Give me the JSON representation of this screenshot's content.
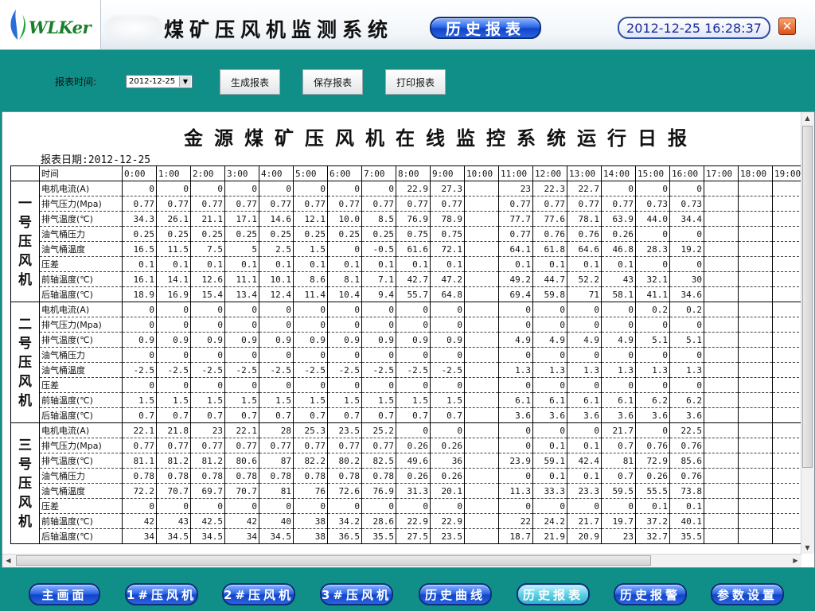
{
  "app": {
    "logo_text": "WLKer",
    "system_title": "煤矿压风机监测系统",
    "section_badge": "历史报表",
    "clock": "2012-12-25 16:28:37",
    "close_glyph": "✕"
  },
  "toolbar": {
    "date_label": "报表时间:",
    "date_value": "2012-12-25",
    "buttons": [
      "生成报表",
      "保存报表",
      "打印报表"
    ]
  },
  "report": {
    "title": "金源煤矿压风机在线监控系统运行日报",
    "date_line": "报表日期:2012-12-25",
    "time_header": "时间",
    "hours": [
      "0:00",
      "1:00",
      "2:00",
      "3:00",
      "4:00",
      "5:00",
      "6:00",
      "7:00",
      "8:00",
      "9:00",
      "10:00",
      "11:00",
      "12:00",
      "13:00",
      "14:00",
      "15:00",
      "16:00",
      "17:00",
      "18:00",
      "19:00"
    ],
    "groups": [
      {
        "name": "一号压风机",
        "rows": [
          {
            "label": "电机电流(A)",
            "values": [
              "0",
              "0",
              "0",
              "0",
              "0",
              "0",
              "0",
              "0",
              "22.9",
              "27.3",
              "",
              "23",
              "22.3",
              "22.7",
              "0",
              "0",
              "0",
              "",
              "",
              ""
            ]
          },
          {
            "label": "排气压力(Mpa)",
            "values": [
              "0.77",
              "0.77",
              "0.77",
              "0.77",
              "0.77",
              "0.77",
              "0.77",
              "0.77",
              "0.77",
              "0.77",
              "",
              "0.77",
              "0.77",
              "0.77",
              "0.77",
              "0.73",
              "0.73",
              "",
              "",
              ""
            ]
          },
          {
            "label": "排气温度(℃)",
            "values": [
              "34.3",
              "26.1",
              "21.1",
              "17.1",
              "14.6",
              "12.1",
              "10.0",
              "8.5",
              "76.9",
              "78.9",
              "",
              "77.7",
              "77.6",
              "78.1",
              "63.9",
              "44.0",
              "34.4",
              "",
              "",
              ""
            ]
          },
          {
            "label": "油气桶压力",
            "values": [
              "0.25",
              "0.25",
              "0.25",
              "0.25",
              "0.25",
              "0.25",
              "0.25",
              "0.25",
              "0.75",
              "0.75",
              "",
              "0.77",
              "0.76",
              "0.76",
              "0.26",
              "0",
              "0",
              "",
              "",
              ""
            ]
          },
          {
            "label": "油气桶温度",
            "values": [
              "16.5",
              "11.5",
              "7.5",
              "5",
              "2.5",
              "1.5",
              "0",
              "-0.5",
              "61.6",
              "72.1",
              "",
              "64.1",
              "61.8",
              "64.6",
              "46.8",
              "28.3",
              "19.2",
              "",
              "",
              ""
            ]
          },
          {
            "label": "压差",
            "values": [
              "0.1",
              "0.1",
              "0.1",
              "0.1",
              "0.1",
              "0.1",
              "0.1",
              "0.1",
              "0.1",
              "0.1",
              "",
              "0.1",
              "0.1",
              "0.1",
              "0.1",
              "0",
              "0",
              "",
              "",
              ""
            ]
          },
          {
            "label": "前轴温度(℃)",
            "values": [
              "16.1",
              "14.1",
              "12.6",
              "11.1",
              "10.1",
              "8.6",
              "8.1",
              "7.1",
              "42.7",
              "47.2",
              "",
              "49.2",
              "44.7",
              "52.2",
              "43",
              "32.1",
              "30",
              "",
              "",
              ""
            ]
          },
          {
            "label": "后轴温度(℃)",
            "values": [
              "18.9",
              "16.9",
              "15.4",
              "13.4",
              "12.4",
              "11.4",
              "10.4",
              "9.4",
              "55.7",
              "64.8",
              "",
              "69.4",
              "59.8",
              "71",
              "58.1",
              "41.1",
              "34.6",
              "",
              "",
              ""
            ]
          }
        ]
      },
      {
        "name": "二号压风机",
        "rows": [
          {
            "label": "电机电流(A)",
            "values": [
              "0",
              "0",
              "0",
              "0",
              "0",
              "0",
              "0",
              "0",
              "0",
              "0",
              "",
              "0",
              "0",
              "0",
              "0",
              "0.2",
              "0.2",
              "",
              "",
              ""
            ]
          },
          {
            "label": "排气压力(Mpa)",
            "values": [
              "0",
              "0",
              "0",
              "0",
              "0",
              "0",
              "0",
              "0",
              "0",
              "0",
              "",
              "0",
              "0",
              "0",
              "0",
              "0",
              "0",
              "",
              "",
              ""
            ]
          },
          {
            "label": "排气温度(℃)",
            "values": [
              "0.9",
              "0.9",
              "0.9",
              "0.9",
              "0.9",
              "0.9",
              "0.9",
              "0.9",
              "0.9",
              "0.9",
              "",
              "4.9",
              "4.9",
              "4.9",
              "4.9",
              "5.1",
              "5.1",
              "",
              "",
              ""
            ]
          },
          {
            "label": "油气桶压力",
            "values": [
              "0",
              "0",
              "0",
              "0",
              "0",
              "0",
              "0",
              "0",
              "0",
              "0",
              "",
              "0",
              "0",
              "0",
              "0",
              "0",
              "0",
              "",
              "",
              ""
            ]
          },
          {
            "label": "油气桶温度",
            "values": [
              "-2.5",
              "-2.5",
              "-2.5",
              "-2.5",
              "-2.5",
              "-2.5",
              "-2.5",
              "-2.5",
              "-2.5",
              "-2.5",
              "",
              "1.3",
              "1.3",
              "1.3",
              "1.3",
              "1.3",
              "1.3",
              "",
              "",
              ""
            ]
          },
          {
            "label": "压差",
            "values": [
              "0",
              "0",
              "0",
              "0",
              "0",
              "0",
              "0",
              "0",
              "0",
              "0",
              "",
              "0",
              "0",
              "0",
              "0",
              "0",
              "0",
              "",
              "",
              ""
            ]
          },
          {
            "label": "前轴温度(℃)",
            "values": [
              "1.5",
              "1.5",
              "1.5",
              "1.5",
              "1.5",
              "1.5",
              "1.5",
              "1.5",
              "1.5",
              "1.5",
              "",
              "6.1",
              "6.1",
              "6.1",
              "6.1",
              "6.2",
              "6.2",
              "",
              "",
              ""
            ]
          },
          {
            "label": "后轴温度(℃)",
            "values": [
              "0.7",
              "0.7",
              "0.7",
              "0.7",
              "0.7",
              "0.7",
              "0.7",
              "0.7",
              "0.7",
              "0.7",
              "",
              "3.6",
              "3.6",
              "3.6",
              "3.6",
              "3.6",
              "3.6",
              "",
              "",
              ""
            ]
          }
        ]
      },
      {
        "name": "三号压风机",
        "rows": [
          {
            "label": "电机电流(A)",
            "values": [
              "22.1",
              "21.8",
              "23",
              "22.1",
              "28",
              "25.3",
              "23.5",
              "25.2",
              "0",
              "0",
              "",
              "0",
              "0",
              "0",
              "21.7",
              "0",
              "22.5",
              "",
              "",
              ""
            ]
          },
          {
            "label": "排气压力(Mpa)",
            "values": [
              "0.77",
              "0.77",
              "0.77",
              "0.77",
              "0.77",
              "0.77",
              "0.77",
              "0.77",
              "0.26",
              "0.26",
              "",
              "0",
              "0.1",
              "0.1",
              "0.7",
              "0.76",
              "0.76",
              "",
              "",
              ""
            ]
          },
          {
            "label": "排气温度(℃)",
            "values": [
              "81.1",
              "81.2",
              "81.2",
              "80.6",
              "87",
              "82.2",
              "80.2",
              "82.5",
              "49.6",
              "36",
              "",
              "23.9",
              "59.1",
              "42.4",
              "81",
              "72.9",
              "85.6",
              "",
              "",
              ""
            ]
          },
          {
            "label": "油气桶压力",
            "values": [
              "0.78",
              "0.78",
              "0.78",
              "0.78",
              "0.78",
              "0.78",
              "0.78",
              "0.78",
              "0.26",
              "0.26",
              "",
              "0",
              "0.1",
              "0.1",
              "0.7",
              "0.26",
              "0.76",
              "",
              "",
              ""
            ]
          },
          {
            "label": "油气桶温度",
            "values": [
              "72.2",
              "70.7",
              "69.7",
              "70.7",
              "81",
              "76",
              "72.6",
              "76.9",
              "31.3",
              "20.1",
              "",
              "11.3",
              "33.3",
              "23.3",
              "59.5",
              "55.5",
              "73.8",
              "",
              "",
              ""
            ]
          },
          {
            "label": "压差",
            "values": [
              "0",
              "0",
              "0",
              "0",
              "0",
              "0",
              "0",
              "0",
              "0",
              "0",
              "",
              "0",
              "0",
              "0",
              "0",
              "0.1",
              "0.1",
              "",
              "",
              ""
            ]
          },
          {
            "label": "前轴温度(℃)",
            "values": [
              "42",
              "43",
              "42.5",
              "42",
              "40",
              "38",
              "34.2",
              "28.6",
              "22.9",
              "22.9",
              "",
              "22",
              "24.2",
              "21.7",
              "19.7",
              "37.2",
              "40.1",
              "",
              "",
              ""
            ]
          },
          {
            "label": "后轴温度(℃)",
            "values": [
              "34",
              "34.5",
              "34.5",
              "34",
              "34.5",
              "38",
              "36.5",
              "35.5",
              "27.5",
              "23.5",
              "",
              "18.7",
              "21.9",
              "20.9",
              "23",
              "32.7",
              "35.5",
              "",
              "",
              ""
            ]
          }
        ]
      }
    ]
  },
  "nav": {
    "buttons": [
      "主画面",
      "1#压风机",
      "2#压风机",
      "3#压风机",
      "历史曲线",
      "历史报表",
      "历史报警",
      "参数设置"
    ],
    "active_index": 5
  },
  "colors": {
    "background": "#0f8f87",
    "button_blue": "#1145c8",
    "button_active": "#5fd0e6"
  }
}
